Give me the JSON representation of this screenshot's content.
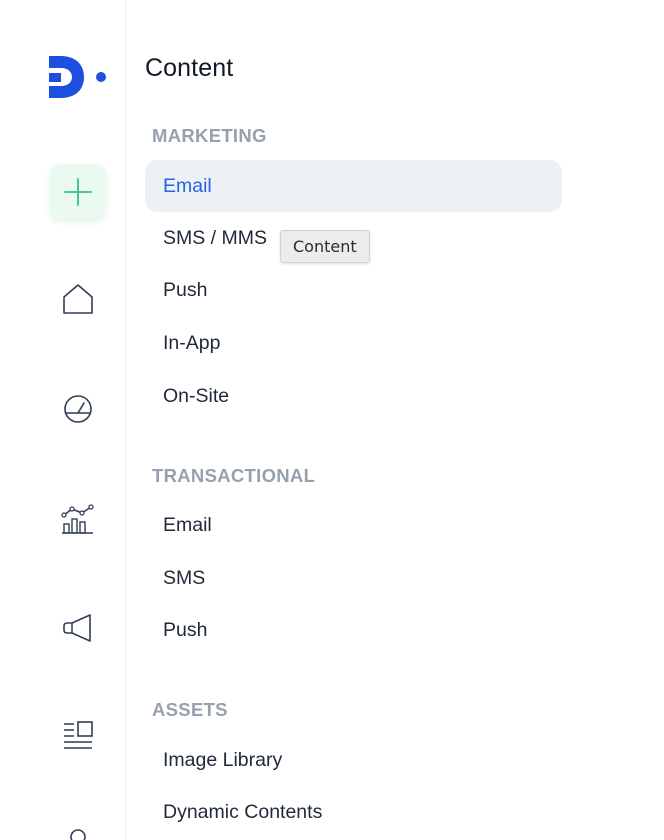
{
  "panel": {
    "title": "Content",
    "sections": {
      "marketing": {
        "label": "MARKETING",
        "items": [
          "Email",
          "SMS / MMS",
          "Push",
          "In-App",
          "On-Site"
        ],
        "active_item": "Email"
      },
      "transactional": {
        "label": "TRANSACTIONAL",
        "items": [
          "Email",
          "SMS",
          "Push"
        ]
      },
      "assets": {
        "label": "ASSETS",
        "items": [
          "Image Library",
          "Dynamic Contents"
        ]
      }
    }
  },
  "tooltip": {
    "text": "Content"
  },
  "rail": {
    "icons": [
      "logo-icon",
      "plus-icon",
      "home-icon",
      "gauge-icon",
      "analytics-icon",
      "megaphone-icon",
      "content-icon"
    ]
  },
  "colors": {
    "accent_blue": "#2563eb",
    "create_green": "#34c47c",
    "create_bg": "#eafaf1",
    "active_bg": "#eef1f4",
    "section_label": "#97a0ad",
    "icon_stroke": "#2f3e55",
    "logo_blue": "#1f4fe0"
  }
}
